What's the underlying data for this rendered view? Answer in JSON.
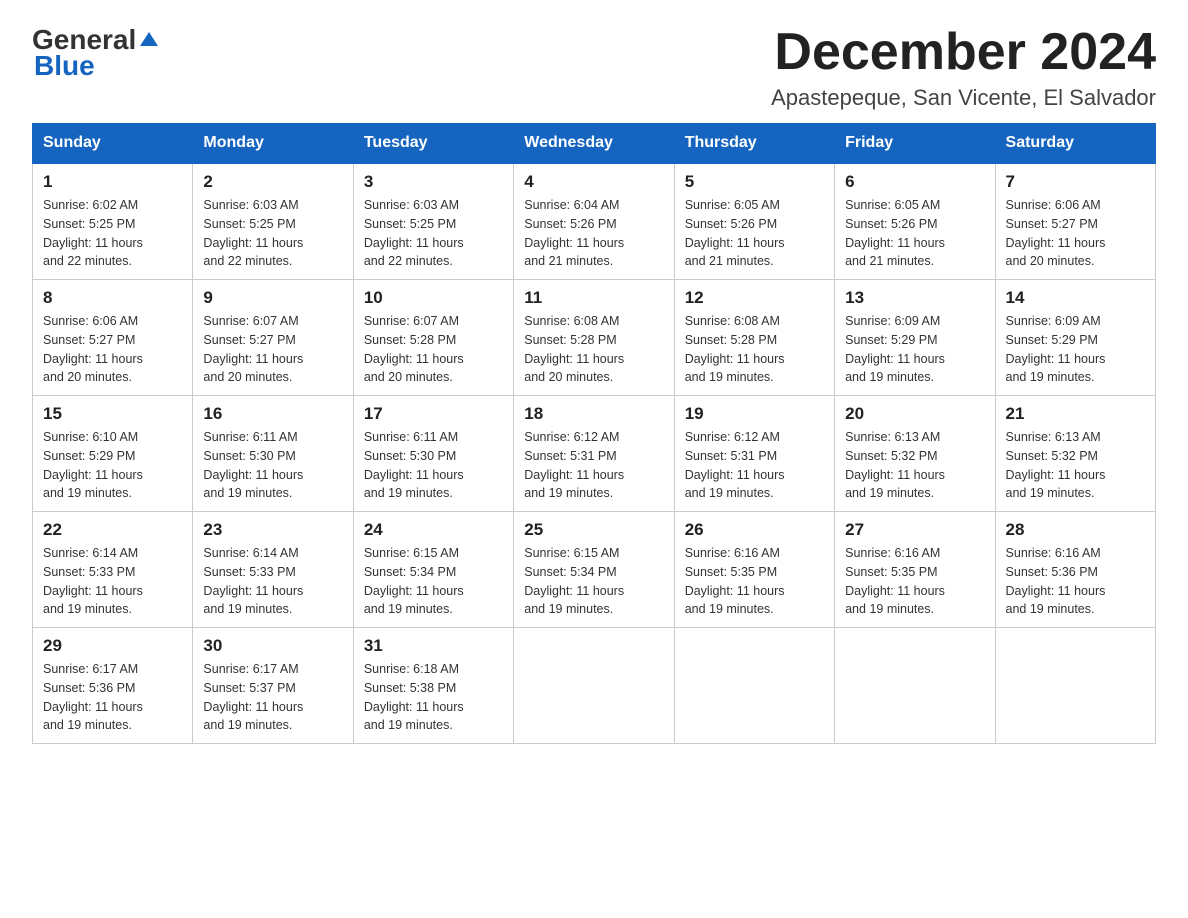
{
  "header": {
    "logo_general": "General",
    "logo_blue": "Blue",
    "title": "December 2024",
    "subtitle": "Apastepeque, San Vicente, El Salvador"
  },
  "days_of_week": [
    "Sunday",
    "Monday",
    "Tuesday",
    "Wednesday",
    "Thursday",
    "Friday",
    "Saturday"
  ],
  "weeks": [
    [
      {
        "day": "1",
        "sunrise": "6:02 AM",
        "sunset": "5:25 PM",
        "daylight": "11 hours and 22 minutes."
      },
      {
        "day": "2",
        "sunrise": "6:03 AM",
        "sunset": "5:25 PM",
        "daylight": "11 hours and 22 minutes."
      },
      {
        "day": "3",
        "sunrise": "6:03 AM",
        "sunset": "5:25 PM",
        "daylight": "11 hours and 22 minutes."
      },
      {
        "day": "4",
        "sunrise": "6:04 AM",
        "sunset": "5:26 PM",
        "daylight": "11 hours and 21 minutes."
      },
      {
        "day": "5",
        "sunrise": "6:05 AM",
        "sunset": "5:26 PM",
        "daylight": "11 hours and 21 minutes."
      },
      {
        "day": "6",
        "sunrise": "6:05 AM",
        "sunset": "5:26 PM",
        "daylight": "11 hours and 21 minutes."
      },
      {
        "day": "7",
        "sunrise": "6:06 AM",
        "sunset": "5:27 PM",
        "daylight": "11 hours and 20 minutes."
      }
    ],
    [
      {
        "day": "8",
        "sunrise": "6:06 AM",
        "sunset": "5:27 PM",
        "daylight": "11 hours and 20 minutes."
      },
      {
        "day": "9",
        "sunrise": "6:07 AM",
        "sunset": "5:27 PM",
        "daylight": "11 hours and 20 minutes."
      },
      {
        "day": "10",
        "sunrise": "6:07 AM",
        "sunset": "5:28 PM",
        "daylight": "11 hours and 20 minutes."
      },
      {
        "day": "11",
        "sunrise": "6:08 AM",
        "sunset": "5:28 PM",
        "daylight": "11 hours and 20 minutes."
      },
      {
        "day": "12",
        "sunrise": "6:08 AM",
        "sunset": "5:28 PM",
        "daylight": "11 hours and 19 minutes."
      },
      {
        "day": "13",
        "sunrise": "6:09 AM",
        "sunset": "5:29 PM",
        "daylight": "11 hours and 19 minutes."
      },
      {
        "day": "14",
        "sunrise": "6:09 AM",
        "sunset": "5:29 PM",
        "daylight": "11 hours and 19 minutes."
      }
    ],
    [
      {
        "day": "15",
        "sunrise": "6:10 AM",
        "sunset": "5:29 PM",
        "daylight": "11 hours and 19 minutes."
      },
      {
        "day": "16",
        "sunrise": "6:11 AM",
        "sunset": "5:30 PM",
        "daylight": "11 hours and 19 minutes."
      },
      {
        "day": "17",
        "sunrise": "6:11 AM",
        "sunset": "5:30 PM",
        "daylight": "11 hours and 19 minutes."
      },
      {
        "day": "18",
        "sunrise": "6:12 AM",
        "sunset": "5:31 PM",
        "daylight": "11 hours and 19 minutes."
      },
      {
        "day": "19",
        "sunrise": "6:12 AM",
        "sunset": "5:31 PM",
        "daylight": "11 hours and 19 minutes."
      },
      {
        "day": "20",
        "sunrise": "6:13 AM",
        "sunset": "5:32 PM",
        "daylight": "11 hours and 19 minutes."
      },
      {
        "day": "21",
        "sunrise": "6:13 AM",
        "sunset": "5:32 PM",
        "daylight": "11 hours and 19 minutes."
      }
    ],
    [
      {
        "day": "22",
        "sunrise": "6:14 AM",
        "sunset": "5:33 PM",
        "daylight": "11 hours and 19 minutes."
      },
      {
        "day": "23",
        "sunrise": "6:14 AM",
        "sunset": "5:33 PM",
        "daylight": "11 hours and 19 minutes."
      },
      {
        "day": "24",
        "sunrise": "6:15 AM",
        "sunset": "5:34 PM",
        "daylight": "11 hours and 19 minutes."
      },
      {
        "day": "25",
        "sunrise": "6:15 AM",
        "sunset": "5:34 PM",
        "daylight": "11 hours and 19 minutes."
      },
      {
        "day": "26",
        "sunrise": "6:16 AM",
        "sunset": "5:35 PM",
        "daylight": "11 hours and 19 minutes."
      },
      {
        "day": "27",
        "sunrise": "6:16 AM",
        "sunset": "5:35 PM",
        "daylight": "11 hours and 19 minutes."
      },
      {
        "day": "28",
        "sunrise": "6:16 AM",
        "sunset": "5:36 PM",
        "daylight": "11 hours and 19 minutes."
      }
    ],
    [
      {
        "day": "29",
        "sunrise": "6:17 AM",
        "sunset": "5:36 PM",
        "daylight": "11 hours and 19 minutes."
      },
      {
        "day": "30",
        "sunrise": "6:17 AM",
        "sunset": "5:37 PM",
        "daylight": "11 hours and 19 minutes."
      },
      {
        "day": "31",
        "sunrise": "6:18 AM",
        "sunset": "5:38 PM",
        "daylight": "11 hours and 19 minutes."
      },
      null,
      null,
      null,
      null
    ]
  ],
  "labels": {
    "sunrise": "Sunrise:",
    "sunset": "Sunset:",
    "daylight": "Daylight:"
  }
}
